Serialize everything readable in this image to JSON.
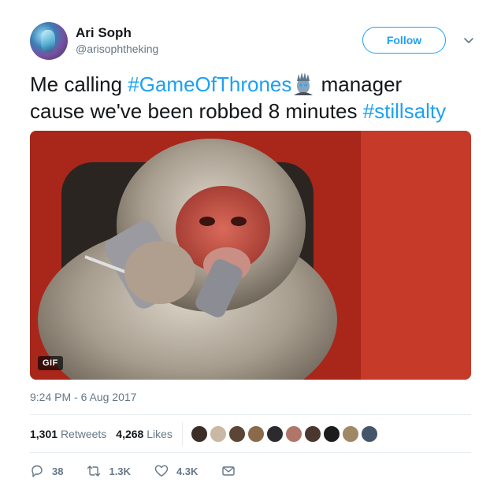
{
  "tweet": {
    "display_name": "Ari Soph",
    "handle": "@arisophtheking",
    "follow_label": "Follow",
    "text_parts": {
      "p1": "Me calling ",
      "hashtag1": "#GameOfThrones",
      "p2": " manager",
      "p3": "cause we've been robbed 8 minutes ",
      "hashtag2": "#stillsalty"
    },
    "emoji": "white-walker-emoji",
    "media_badge": "GIF",
    "timestamp": "9:24 PM - 6 Aug 2017",
    "retweets_count": "1,301",
    "retweets_label": "Retweets",
    "likes_count": "4,268",
    "likes_label": "Likes",
    "likers_avatar_count": 10,
    "replies": "38",
    "retweets_short": "1.3K",
    "likes_short": "4.3K"
  },
  "colors": {
    "accent": "#1da1f2",
    "text": "#14171a",
    "muted": "#657786",
    "divider": "#e6ecf0"
  },
  "icons": [
    "chevron-down-icon",
    "reply-icon",
    "retweet-icon",
    "like-icon",
    "message-icon"
  ]
}
